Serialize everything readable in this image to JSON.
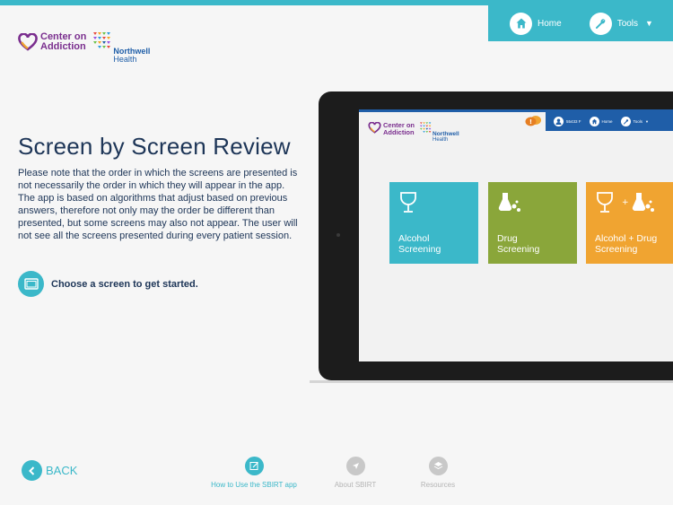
{
  "header": {
    "home_label": "Home",
    "tools_label": "Tools"
  },
  "logo": {
    "cona_line1": "Center on",
    "cona_line2": "Addiction",
    "northwell_name": "Northwell",
    "northwell_health": "Health"
  },
  "main": {
    "title": "Screen by Screen Review",
    "description": "Please note that the order in which the screens are presented is not necessarily the order in which they will appear in the app. The app is based on algorithms that adjust based on previous answers, therefore not only may the order be different than presented, but some screens may also not appear. The user will not see all the screens presented during every patient session.",
    "choose_label": "Choose a screen to get started."
  },
  "tablet_screen": {
    "user_id": "55433 F",
    "home_label": "Home",
    "tools_label": "Tools",
    "tiles": [
      {
        "label_line1": "Alcohol",
        "label_line2": "Screening"
      },
      {
        "label_line1": "Drug",
        "label_line2": "Screening"
      },
      {
        "label_line1": "Alcohol + Drug",
        "label_line2": "Screening"
      }
    ]
  },
  "footer": {
    "back_label": "BACK",
    "nav": [
      {
        "label": "How to Use the SBIRT app"
      },
      {
        "label": "About SBIRT"
      },
      {
        "label": "Resources"
      }
    ]
  },
  "colors": {
    "accent": "#3bb8c9",
    "navy": "#1d3557",
    "brand_purple": "#7a2e8e",
    "brand_blue": "#1f5ea8",
    "drug_green": "#8aa63a",
    "combo_orange": "#f0a431",
    "inactive_gray": "#c8c8c8"
  }
}
